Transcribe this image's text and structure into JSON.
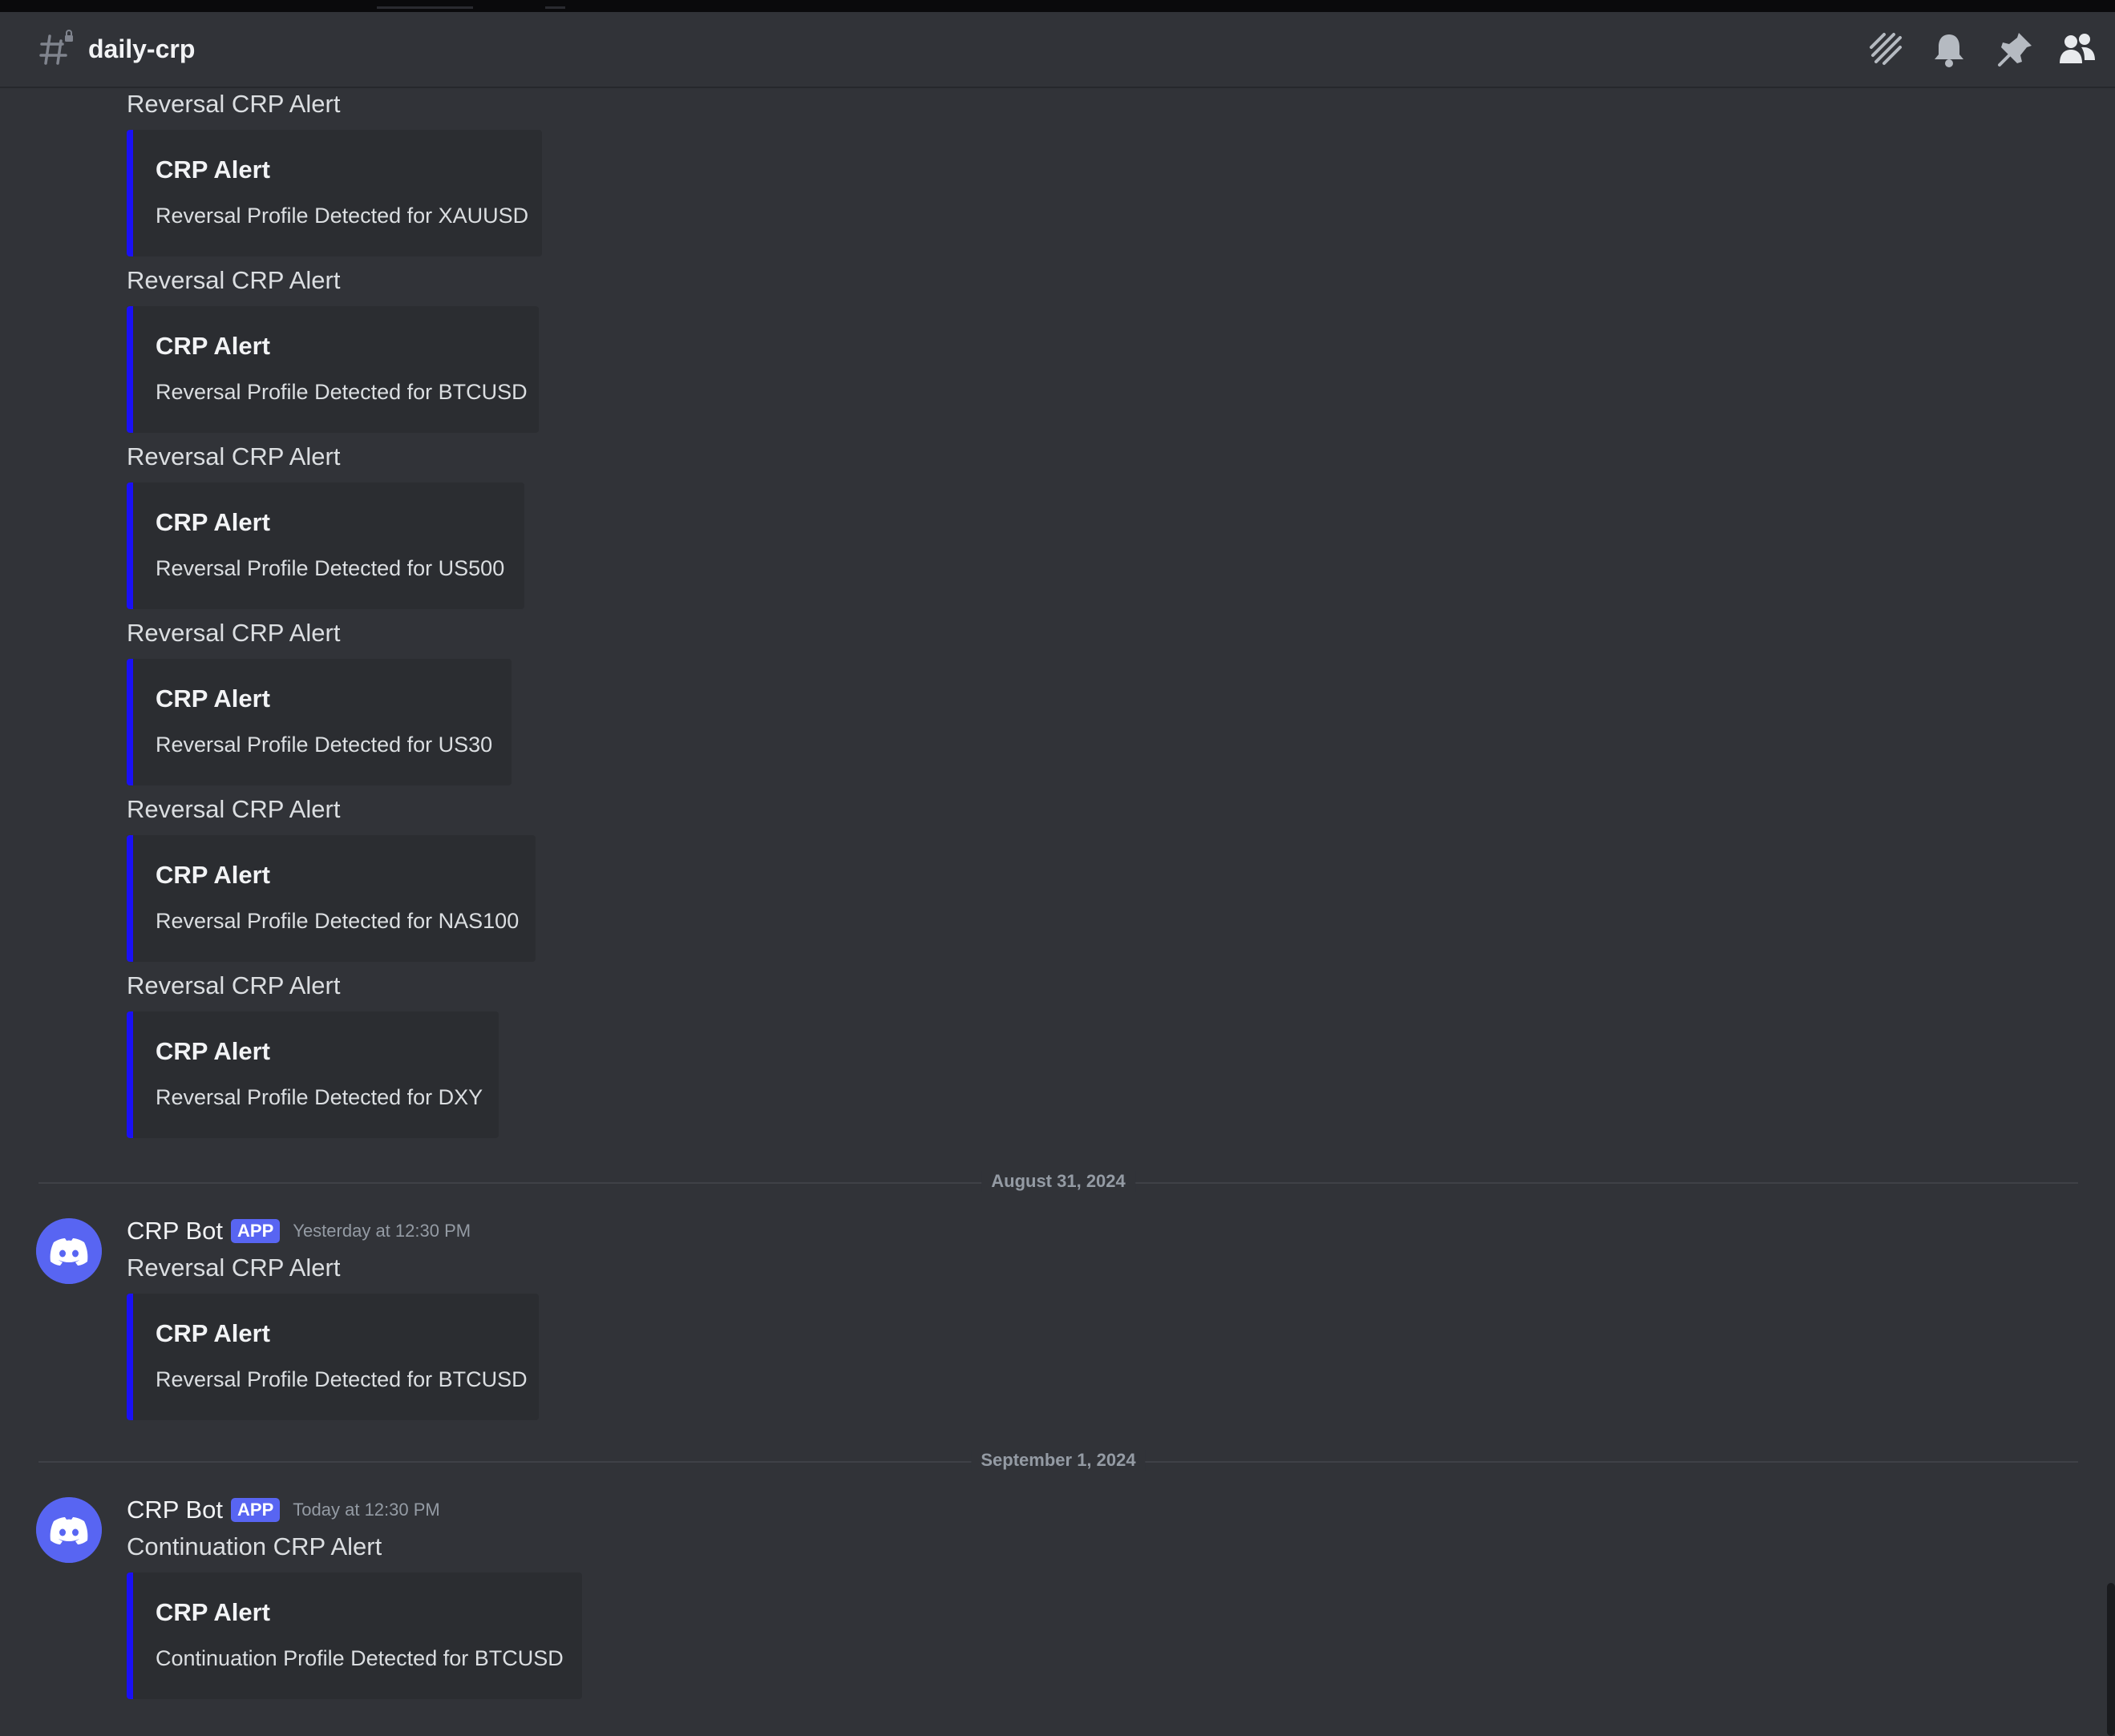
{
  "header": {
    "channel_name": "daily-crp",
    "icons": [
      "threads-icon",
      "bell-icon",
      "pin-icon",
      "members-icon"
    ]
  },
  "colors": {
    "background": "#313338",
    "embed_background": "#2b2d31",
    "embed_accent": "#1a10f5",
    "app_badge": "#5865f2",
    "avatar": "#5865f2"
  },
  "messages": [
    {
      "content": "Reversal CRP Alert",
      "embed": {
        "title": "CRP Alert",
        "description": "Reversal Profile Detected for XAUUSD"
      }
    },
    {
      "content": "Reversal CRP Alert",
      "embed": {
        "title": "CRP Alert",
        "description": "Reversal Profile Detected for BTCUSD"
      }
    },
    {
      "content": "Reversal CRP Alert",
      "embed": {
        "title": "CRP Alert",
        "description": "Reversal Profile Detected for US500"
      }
    },
    {
      "content": "Reversal CRP Alert",
      "embed": {
        "title": "CRP Alert",
        "description": "Reversal Profile Detected for US30"
      }
    },
    {
      "content": "Reversal CRP Alert",
      "embed": {
        "title": "CRP Alert",
        "description": "Reversal Profile Detected for NAS100"
      }
    },
    {
      "content": "Reversal CRP Alert",
      "embed": {
        "title": "CRP Alert",
        "description": "Reversal Profile Detected for DXY"
      }
    }
  ],
  "dividers": [
    "August 31, 2024",
    "September 1, 2024"
  ],
  "posts": [
    {
      "author": "CRP Bot",
      "badge": "APP",
      "timestamp": "Yesterday at 12:30 PM",
      "content": "Reversal CRP Alert",
      "embed": {
        "title": "CRP Alert",
        "description": "Reversal Profile Detected for BTCUSD"
      }
    },
    {
      "author": "CRP Bot",
      "badge": "APP",
      "timestamp": "Today at 12:30 PM",
      "content": "Continuation CRP Alert",
      "embed": {
        "title": "CRP Alert",
        "description": "Continuation Profile Detected for BTCUSD"
      }
    }
  ]
}
